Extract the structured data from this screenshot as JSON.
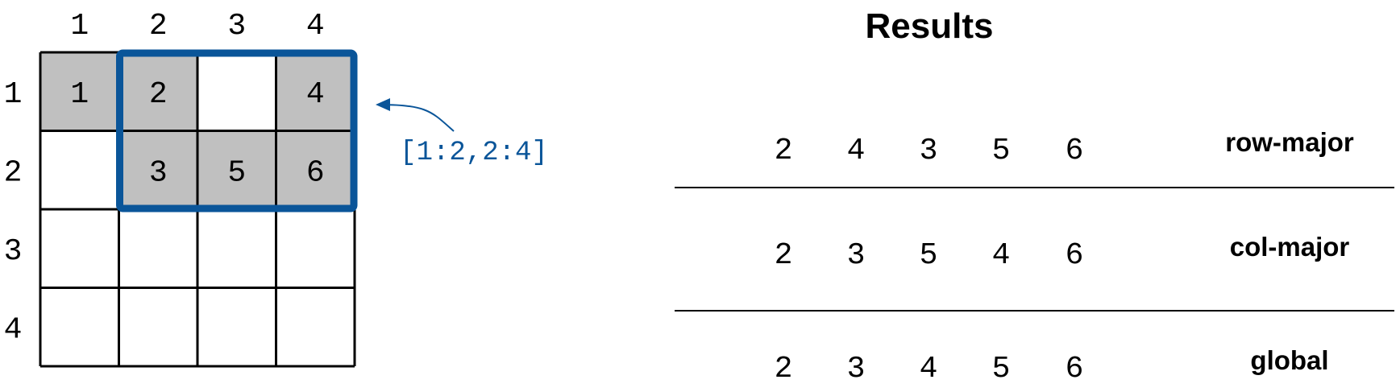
{
  "grid": {
    "col_headers": [
      "1",
      "2",
      "3",
      "4"
    ],
    "row_headers": [
      "1",
      "2",
      "3",
      "4"
    ],
    "cells": [
      [
        "1",
        "2",
        "",
        "4"
      ],
      [
        "",
        "3",
        "5",
        "6"
      ],
      [
        "",
        "",
        "",
        ""
      ],
      [
        "",
        "",
        "",
        ""
      ]
    ],
    "filled": [
      [
        true,
        true,
        false,
        true
      ],
      [
        false,
        true,
        true,
        true
      ],
      [
        false,
        false,
        false,
        false
      ],
      [
        false,
        false,
        false,
        false
      ]
    ],
    "selection": {
      "rows": [
        1,
        2
      ],
      "cols": [
        2,
        4
      ]
    },
    "selection_label": "[1:2,2:4]"
  },
  "results": {
    "title": "Results",
    "rows": [
      {
        "values": [
          "2",
          "4",
          "3",
          "5",
          "6"
        ],
        "label": "row-major"
      },
      {
        "values": [
          "2",
          "3",
          "5",
          "4",
          "6"
        ],
        "label": "col-major"
      },
      {
        "values": [
          "2",
          "3",
          "4",
          "5",
          "6"
        ],
        "label": "global"
      }
    ]
  },
  "colors": {
    "selection": "#0a5599",
    "filled_cell": "#c0c0c0",
    "grid_line": "#000000",
    "text": "#000000"
  }
}
